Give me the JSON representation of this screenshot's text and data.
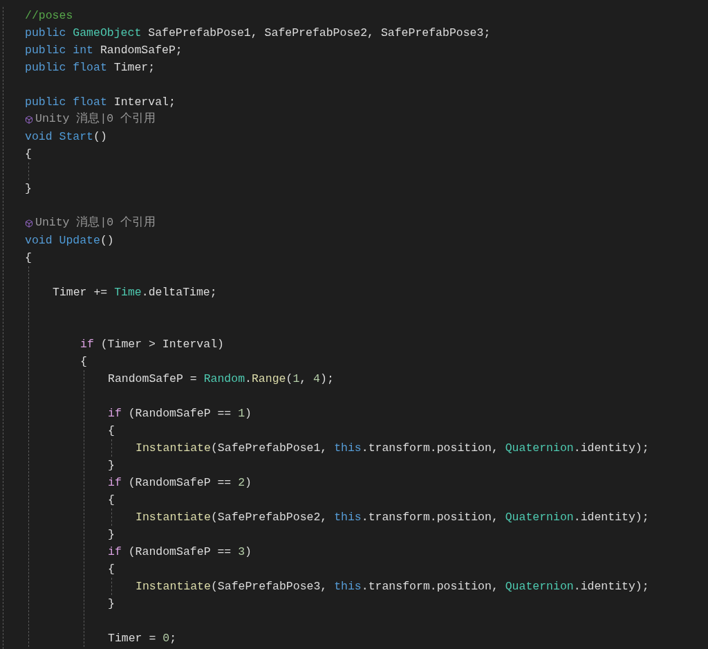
{
  "editor": {
    "lines": [
      {
        "kind": "code",
        "tokens": [
          {
            "text": "//poses",
            "kind": "comment"
          }
        ]
      },
      {
        "kind": "code",
        "tokens": [
          {
            "text": "public ",
            "kind": "keyword"
          },
          {
            "text": "GameObject",
            "kind": "type"
          },
          {
            "text": " SafePrefabPose1, SafePrefabPose2, SafePrefabPose3;",
            "kind": "plain"
          }
        ]
      },
      {
        "kind": "code",
        "tokens": [
          {
            "text": "public ",
            "kind": "keyword"
          },
          {
            "text": "int",
            "kind": "keyword"
          },
          {
            "text": " RandomSafeP;",
            "kind": "plain"
          }
        ]
      },
      {
        "kind": "code",
        "tokens": [
          {
            "text": "public ",
            "kind": "keyword"
          },
          {
            "text": "float",
            "kind": "keyword"
          },
          {
            "text": " Timer;",
            "kind": "plain"
          }
        ]
      },
      {
        "kind": "blank"
      },
      {
        "kind": "code",
        "tokens": [
          {
            "text": "public ",
            "kind": "keyword"
          },
          {
            "text": "float",
            "kind": "keyword"
          },
          {
            "text": " Interval;",
            "kind": "plain"
          }
        ]
      },
      {
        "kind": "lens",
        "text": "Unity 消息|0 个引用"
      },
      {
        "kind": "code",
        "tokens": [
          {
            "text": "void ",
            "kind": "keyword"
          },
          {
            "text": "Start",
            "kind": "method"
          },
          {
            "text": "()",
            "kind": "plain"
          }
        ]
      },
      {
        "kind": "block",
        "open": "{",
        "close": "}",
        "children": [
          {
            "kind": "blank"
          }
        ]
      },
      {
        "kind": "blank"
      },
      {
        "kind": "lens",
        "text": "Unity 消息|0 个引用"
      },
      {
        "kind": "code",
        "tokens": [
          {
            "text": "void ",
            "kind": "keyword"
          },
          {
            "text": "Update",
            "kind": "method"
          },
          {
            "text": "()",
            "kind": "plain"
          }
        ]
      },
      {
        "kind": "block",
        "open": "{",
        "children": [
          {
            "kind": "blank"
          },
          {
            "kind": "code",
            "tokens": [
              {
                "text": "Timer += ",
                "kind": "plain"
              },
              {
                "text": "Time",
                "kind": "type"
              },
              {
                "text": ".deltaTime;",
                "kind": "plain"
              }
            ]
          },
          {
            "kind": "blank"
          },
          {
            "kind": "blank"
          },
          {
            "kind": "group",
            "children": [
              {
                "kind": "code",
                "tokens": [
                  {
                    "text": "if",
                    "kind": "control"
                  },
                  {
                    "text": " (Timer > Interval)",
                    "kind": "plain"
                  }
                ]
              },
              {
                "kind": "block",
                "open": "{",
                "children": [
                  {
                    "kind": "code",
                    "tokens": [
                      {
                        "text": "RandomSafeP = ",
                        "kind": "plain"
                      },
                      {
                        "text": "Random",
                        "kind": "type"
                      },
                      {
                        "text": ".",
                        "kind": "plain"
                      },
                      {
                        "text": "Range",
                        "kind": "call"
                      },
                      {
                        "text": "(",
                        "kind": "plain"
                      },
                      {
                        "text": "1",
                        "kind": "number"
                      },
                      {
                        "text": ", ",
                        "kind": "plain"
                      },
                      {
                        "text": "4",
                        "kind": "number"
                      },
                      {
                        "text": ");",
                        "kind": "plain"
                      }
                    ]
                  },
                  {
                    "kind": "blank"
                  },
                  {
                    "kind": "code",
                    "tokens": [
                      {
                        "text": "if",
                        "kind": "control"
                      },
                      {
                        "text": " (RandomSafeP == ",
                        "kind": "plain"
                      },
                      {
                        "text": "1",
                        "kind": "number"
                      },
                      {
                        "text": ")",
                        "kind": "plain"
                      }
                    ]
                  },
                  {
                    "kind": "block",
                    "open": "{",
                    "close": "}",
                    "children": [
                      {
                        "kind": "code",
                        "tokens": [
                          {
                            "text": "Instantiate",
                            "kind": "call"
                          },
                          {
                            "text": "(SafePrefabPose1, ",
                            "kind": "plain"
                          },
                          {
                            "text": "this",
                            "kind": "keyword"
                          },
                          {
                            "text": ".transform.position, ",
                            "kind": "plain"
                          },
                          {
                            "text": "Quaternion",
                            "kind": "type"
                          },
                          {
                            "text": ".identity);",
                            "kind": "plain"
                          }
                        ]
                      }
                    ]
                  },
                  {
                    "kind": "code",
                    "tokens": [
                      {
                        "text": "if",
                        "kind": "control"
                      },
                      {
                        "text": " (RandomSafeP == ",
                        "kind": "plain"
                      },
                      {
                        "text": "2",
                        "kind": "number"
                      },
                      {
                        "text": ")",
                        "kind": "plain"
                      }
                    ]
                  },
                  {
                    "kind": "block",
                    "open": "{",
                    "close": "}",
                    "children": [
                      {
                        "kind": "code",
                        "tokens": [
                          {
                            "text": "Instantiate",
                            "kind": "call"
                          },
                          {
                            "text": "(SafePrefabPose2, ",
                            "kind": "plain"
                          },
                          {
                            "text": "this",
                            "kind": "keyword"
                          },
                          {
                            "text": ".transform.position, ",
                            "kind": "plain"
                          },
                          {
                            "text": "Quaternion",
                            "kind": "type"
                          },
                          {
                            "text": ".identity);",
                            "kind": "plain"
                          }
                        ]
                      }
                    ]
                  },
                  {
                    "kind": "code",
                    "tokens": [
                      {
                        "text": "if",
                        "kind": "control"
                      },
                      {
                        "text": " (RandomSafeP == ",
                        "kind": "plain"
                      },
                      {
                        "text": "3",
                        "kind": "number"
                      },
                      {
                        "text": ")",
                        "kind": "plain"
                      }
                    ]
                  },
                  {
                    "kind": "block",
                    "open": "{",
                    "close": "}",
                    "children": [
                      {
                        "kind": "code",
                        "tokens": [
                          {
                            "text": "Instantiate",
                            "kind": "call"
                          },
                          {
                            "text": "(SafePrefabPose3, ",
                            "kind": "plain"
                          },
                          {
                            "text": "this",
                            "kind": "keyword"
                          },
                          {
                            "text": ".transform.position, ",
                            "kind": "plain"
                          },
                          {
                            "text": "Quaternion",
                            "kind": "type"
                          },
                          {
                            "text": ".identity);",
                            "kind": "plain"
                          }
                        ]
                      }
                    ]
                  },
                  {
                    "kind": "blank"
                  },
                  {
                    "kind": "code",
                    "tokens": [
                      {
                        "text": "Timer = ",
                        "kind": "plain"
                      },
                      {
                        "text": "0",
                        "kind": "number"
                      },
                      {
                        "text": ";",
                        "kind": "plain"
                      }
                    ]
                  }
                ]
              }
            ]
          }
        ]
      }
    ]
  }
}
